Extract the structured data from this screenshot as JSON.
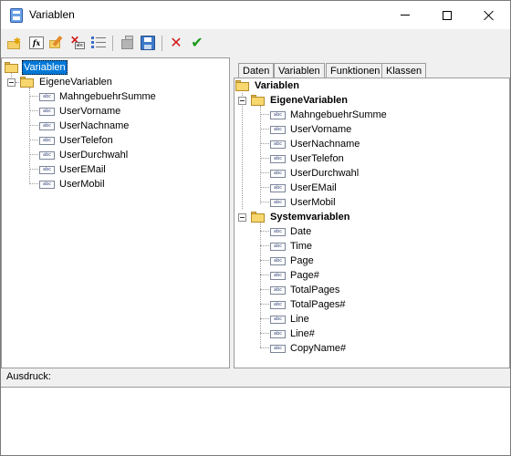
{
  "window": {
    "title": "Variablen"
  },
  "toolbar": {
    "buttons": [
      {
        "name": "new-folder",
        "icon": "folder-new-icon"
      },
      {
        "name": "new-formula",
        "icon": "fx-icon",
        "glyph": "fx"
      },
      {
        "name": "edit",
        "icon": "edit-icon"
      },
      {
        "name": "delete",
        "icon": "delete-icon"
      },
      {
        "name": "list",
        "icon": "list-icon"
      },
      {
        "name": "copy",
        "icon": "copy-icon"
      },
      {
        "name": "save",
        "icon": "save-icon"
      },
      {
        "name": "cancel",
        "icon": "cancel-icon",
        "glyph": "✕",
        "color": "#d21a1a"
      },
      {
        "name": "ok",
        "icon": "check-icon",
        "glyph": "✔",
        "color": "#1c9a1c"
      }
    ]
  },
  "left_tree": {
    "root": "Variablen",
    "group": "EigeneVariablen",
    "items": [
      "MahngebuehrSumme",
      "UserVorname",
      "UserNachname",
      "UserTelefon",
      "UserDurchwahl",
      "UserEMail",
      "UserMobil"
    ]
  },
  "tabs": [
    "Daten",
    "Variablen",
    "Funktionen",
    "Klassen"
  ],
  "active_tab": "Variablen",
  "right_tree": {
    "root": "Variablen",
    "groups": [
      {
        "label": "EigeneVariablen",
        "items": [
          "MahngebuehrSumme",
          "UserVorname",
          "UserNachname",
          "UserTelefon",
          "UserDurchwahl",
          "UserEMail",
          "UserMobil"
        ]
      },
      {
        "label": "Systemvariablen",
        "items": [
          "Date",
          "Time",
          "Page",
          "Page#",
          "TotalPages",
          "TotalPages#",
          "Line",
          "Line#",
          "CopyName#"
        ]
      }
    ]
  },
  "ausdruck": {
    "label": "Ausdruck:",
    "value": ""
  },
  "icon_text": {
    "abc": "abc"
  }
}
